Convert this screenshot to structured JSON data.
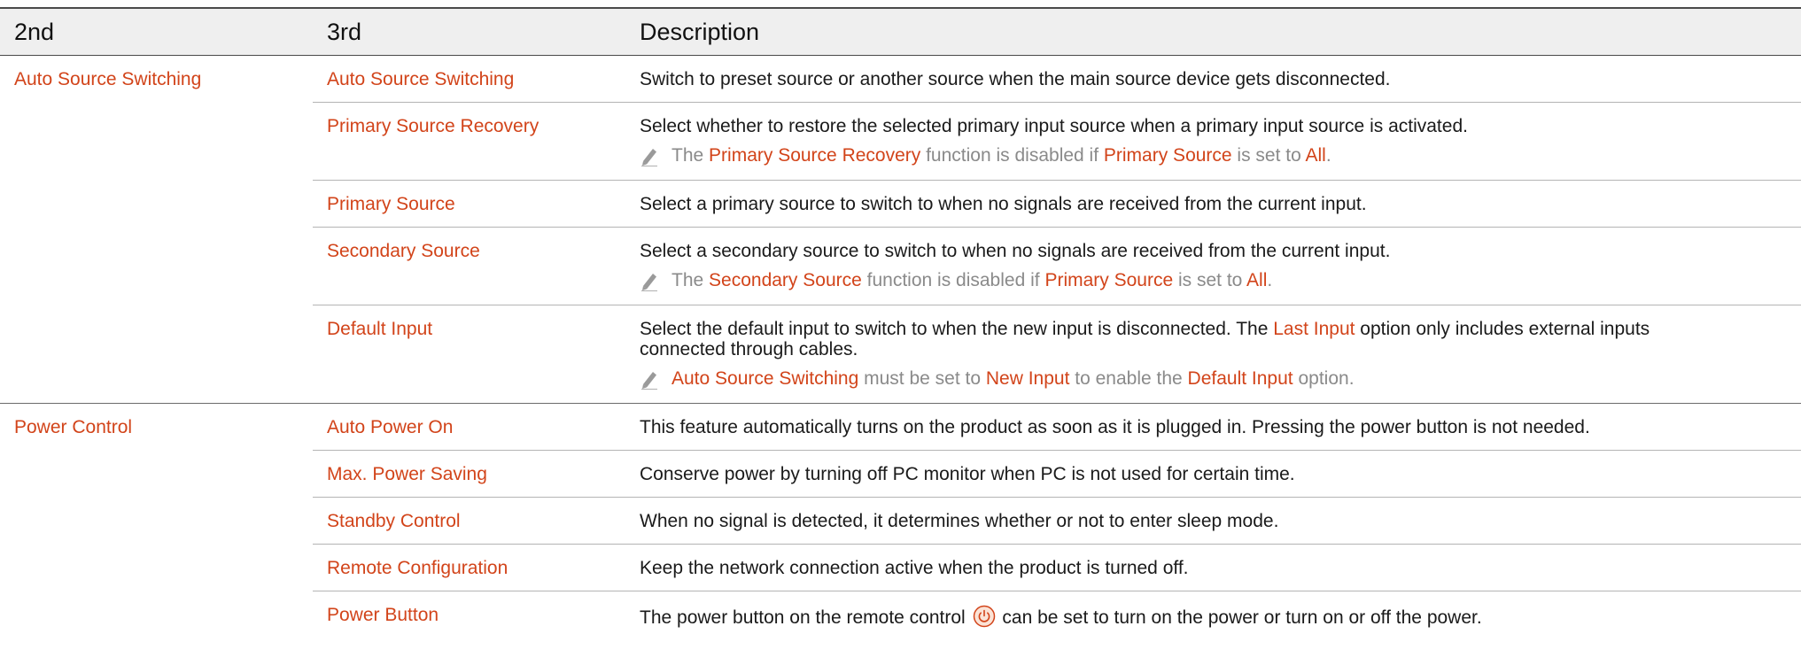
{
  "header": {
    "col1": "2nd",
    "col2": "3rd",
    "col3": "Description"
  },
  "groups": {
    "auto_source": {
      "label": "Auto Source Switching",
      "rows": {
        "r1": {
          "name": "Auto Source Switching",
          "desc": "Switch to preset source or another source when the main source device gets disconnected."
        },
        "r2": {
          "name": "Primary Source Recovery",
          "desc": "Select whether to restore the selected primary input source when a primary input source is activated.",
          "note": {
            "t1": "The ",
            "t2": "Primary Source Recovery",
            "t3": " function is disabled if ",
            "t4": "Primary Source",
            "t5": " is set to ",
            "t6": "All",
            "t7": "."
          }
        },
        "r3": {
          "name": "Primary Source",
          "desc": "Select a primary source to switch to when no signals are received from the current input."
        },
        "r4": {
          "name": "Secondary Source",
          "desc": "Select a secondary source to switch to when no signals are received from the current input.",
          "note": {
            "t1": "The ",
            "t2": "Secondary Source",
            "t3": " function is disabled if ",
            "t4": "Primary Source",
            "t5": " is set to ",
            "t6": "All",
            "t7": "."
          }
        },
        "r5": {
          "name": "Default Input",
          "desc_a": "Select the default input to switch to when the new input is disconnected. The ",
          "desc_b": "Last Input",
          "desc_c": " option only includes external inputs",
          "desc_d": "connected through cables.",
          "note": {
            "t1": "Auto Source Switching",
            "t2": " must be set to ",
            "t3": "New Input",
            "t4": " to enable the ",
            "t5": "Default Input",
            "t6": " option."
          }
        }
      }
    },
    "power_control": {
      "label": "Power Control",
      "rows": {
        "r1": {
          "name": "Auto Power On",
          "desc": "This feature automatically turns on the product as soon as it is plugged in. Pressing the power button is not needed."
        },
        "r2": {
          "name": "Max. Power Saving",
          "desc": "Conserve power by turning off PC monitor when PC is not used for certain time."
        },
        "r3": {
          "name": "Standby Control",
          "desc": "When no signal is detected, it determines whether or not to enter sleep mode."
        },
        "r4": {
          "name": "Remote Configuration",
          "desc": "Keep the network connection active when the product is turned off."
        },
        "r5": {
          "name": "Power Button",
          "desc_a": "The power button on the remote control",
          "desc_b": "can be set to turn on the power or turn on or off the power."
        }
      }
    }
  },
  "colors": {
    "accent": "#d2441a",
    "note_text": "#8a8a8a",
    "header_bg": "#efefef"
  },
  "icons": {
    "note": "pencil-note-icon",
    "power": "power-button-icon"
  }
}
